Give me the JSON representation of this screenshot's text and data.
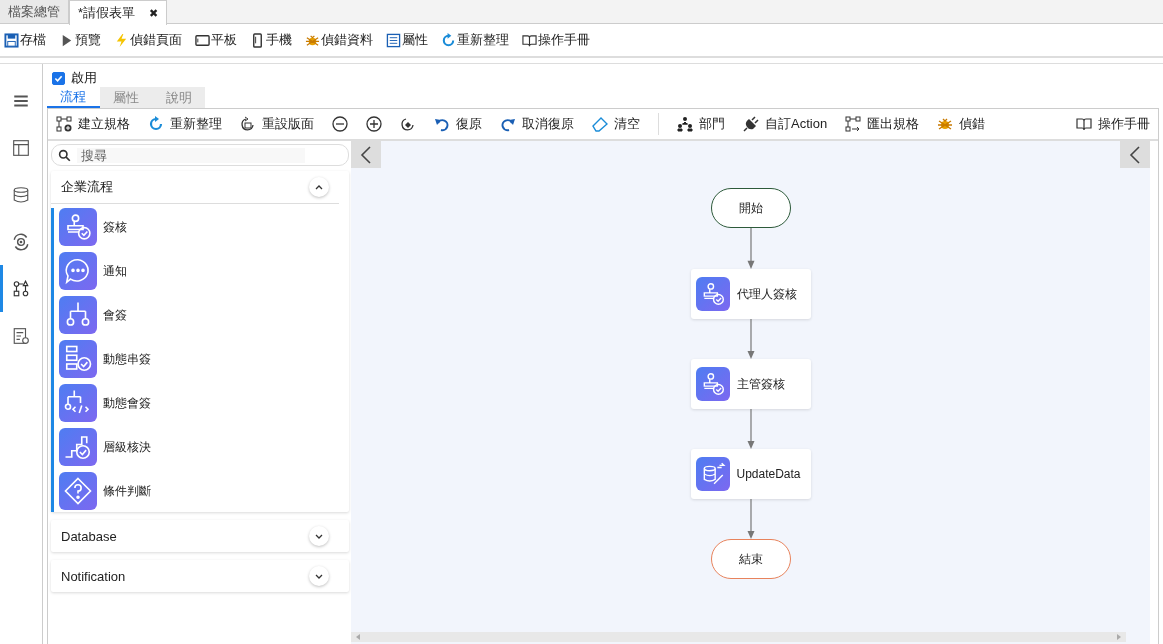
{
  "file_tabs": [
    {
      "label": "檔案總管",
      "selected": false
    },
    {
      "label": "*請假表單",
      "selected": true,
      "close": "✖"
    }
  ],
  "toolbar": [
    {
      "label": "存檔",
      "kind": "save"
    },
    {
      "label": "預覽",
      "kind": "play"
    },
    {
      "label": "偵錯頁面",
      "kind": "bolt"
    },
    {
      "label": "平板",
      "kind": "tablet"
    },
    {
      "label": "手機",
      "kind": "phone"
    },
    {
      "label": "偵錯資料",
      "kind": "bug"
    },
    {
      "label": "屬性",
      "kind": "list"
    },
    {
      "label": "重新整理",
      "kind": "refresh"
    },
    {
      "label": "操作手冊",
      "kind": "book"
    }
  ],
  "rail": [
    {
      "kind": "menu",
      "selected": false
    },
    {
      "kind": "layout",
      "selected": false
    },
    {
      "kind": "database",
      "selected": false
    },
    {
      "kind": "sync",
      "selected": false
    },
    {
      "kind": "flow",
      "selected": true
    },
    {
      "kind": "report",
      "selected": false
    }
  ],
  "enabled": {
    "label": "啟用",
    "checked": true
  },
  "view_tabs": [
    {
      "label": "流程",
      "selected": true
    },
    {
      "label": "屬性",
      "selected": false
    },
    {
      "label": "說明",
      "selected": false
    }
  ],
  "flow_toolbar": {
    "items": [
      {
        "label": "建立規格",
        "kind": "nodes"
      },
      {
        "label": "重新整理",
        "kind": "refresh"
      },
      {
        "label": "重設版面",
        "kind": "resetlayout"
      },
      {
        "kind": "zoomout"
      },
      {
        "kind": "zoomin"
      },
      {
        "kind": "fit"
      },
      {
        "label": "復原",
        "kind": "undo"
      },
      {
        "label": "取消復原",
        "kind": "redo"
      },
      {
        "label": "清空",
        "kind": "eraser"
      },
      {
        "kind": "separator"
      },
      {
        "label": "部門",
        "kind": "org"
      },
      {
        "label": "自訂Action",
        "kind": "plug"
      },
      {
        "label": "匯出規格",
        "kind": "export"
      },
      {
        "label": "偵錯",
        "kind": "bug"
      }
    ],
    "right": {
      "label": "操作手冊",
      "kind": "book"
    }
  },
  "search": {
    "placeholder": "搜尋"
  },
  "palette": [
    {
      "title": "企業流程",
      "expanded": true,
      "items": [
        {
          "label": "簽核",
          "kind": "stamp"
        },
        {
          "label": "通知",
          "kind": "chat"
        },
        {
          "label": "會簽",
          "kind": "branch"
        },
        {
          "label": "動態串簽",
          "kind": "flowlist"
        },
        {
          "label": "動態會簽",
          "kind": "branchcode"
        },
        {
          "label": "層級核決",
          "kind": "stairs"
        },
        {
          "label": "條件判斷",
          "kind": "decision"
        }
      ]
    },
    {
      "title": "Database",
      "expanded": false
    },
    {
      "title": "Notification",
      "expanded": false
    }
  ],
  "flow": [
    {
      "kind": "start",
      "label": "開始"
    },
    {
      "kind": "approval",
      "label": "代理人簽核"
    },
    {
      "kind": "approval",
      "label": "主管簽核"
    },
    {
      "kind": "update",
      "label": "UpdateData"
    },
    {
      "kind": "end",
      "label": "結束"
    }
  ]
}
